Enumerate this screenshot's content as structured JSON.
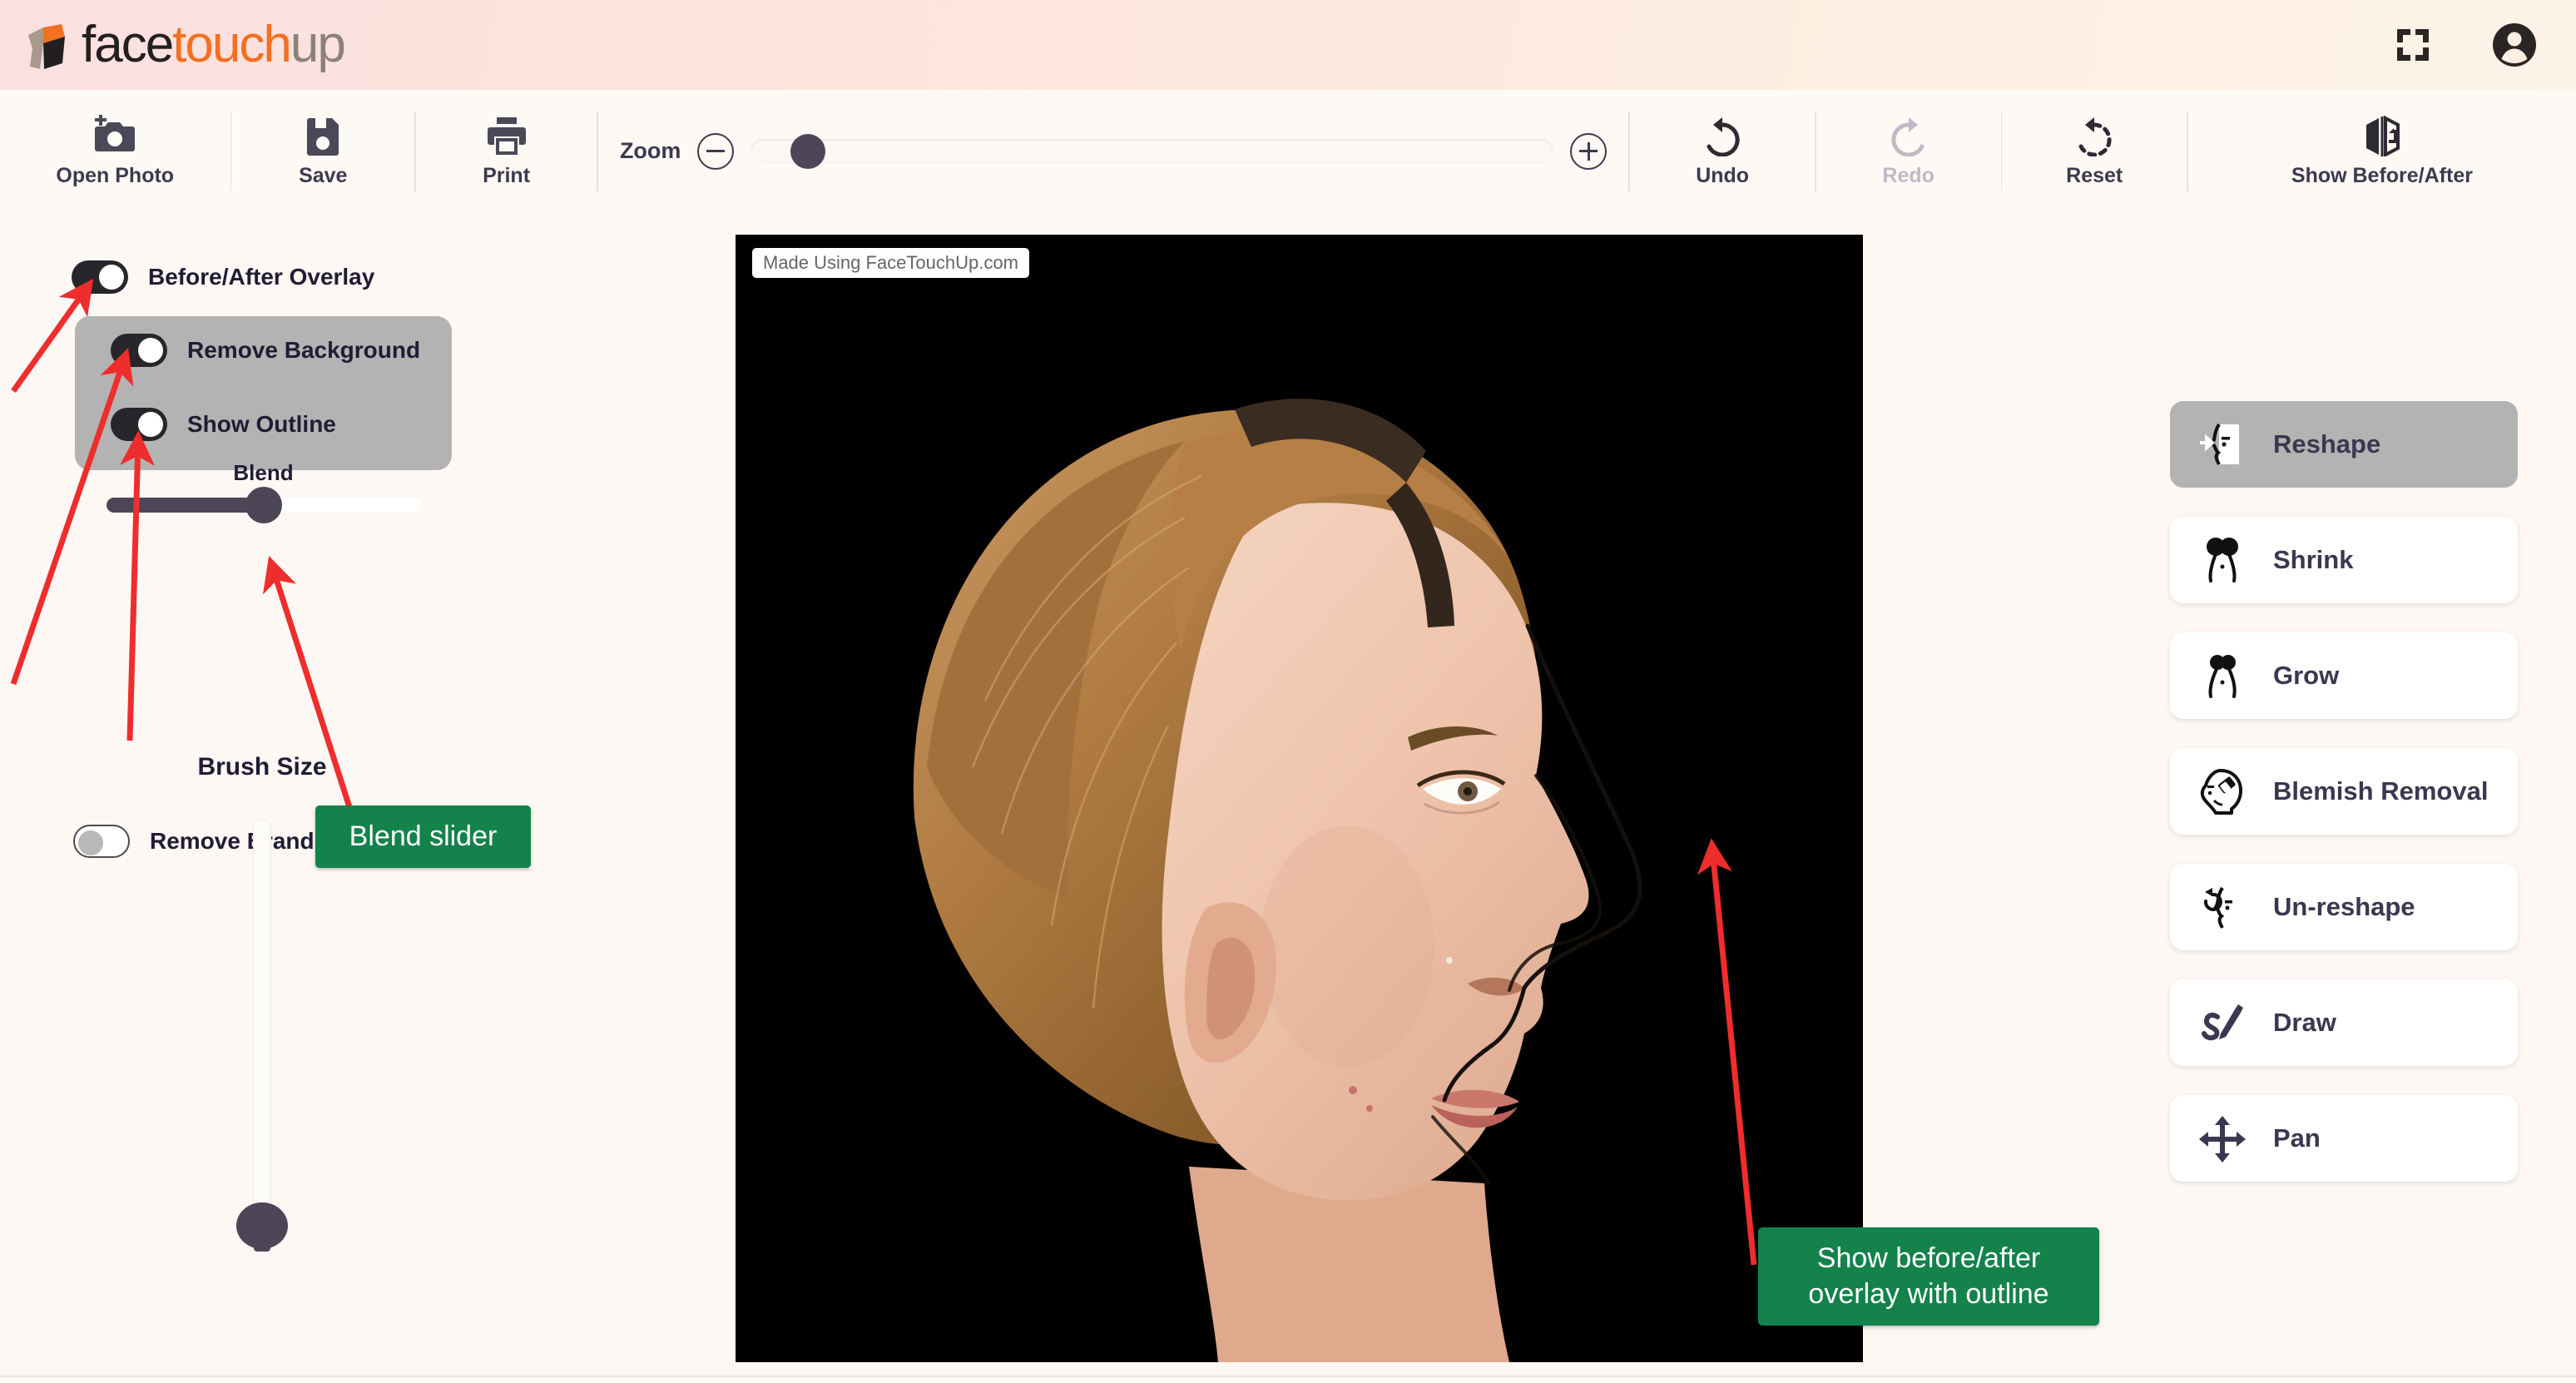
{
  "header": {
    "brand": {
      "part1": "face",
      "part2": "touch",
      "part3": "up"
    },
    "fullscreen_icon": "fullscreen-icon",
    "account_icon": "account-avatar-icon"
  },
  "toolbar": {
    "open_photo": "Open Photo",
    "save": "Save",
    "print": "Print",
    "zoom_label": "Zoom",
    "zoom_out": "zoom-out-icon",
    "zoom_in": "zoom-in-icon",
    "zoom_value": 5,
    "undo": "Undo",
    "redo": "Redo",
    "redo_disabled": true,
    "reset": "Reset",
    "show_before_after": "Show Before/After"
  },
  "left_panel": {
    "before_after_overlay": {
      "label": "Before/After Overlay",
      "on": true
    },
    "remove_background": {
      "label": "Remove Background",
      "on": true
    },
    "show_outline": {
      "label": "Show Outline",
      "on": true
    },
    "blend": {
      "label": "Blend",
      "value": 50
    },
    "remove_branding": {
      "label": "Remove Branding",
      "on": false
    },
    "brush_size": {
      "label": "Brush Size",
      "value": 0
    }
  },
  "canvas": {
    "watermark": "Made Using FaceTouchUp.com"
  },
  "tools": [
    {
      "label": "Reshape",
      "icon": "face-profile-reshape-icon",
      "active": true
    },
    {
      "label": "Shrink",
      "icon": "shrink-pinch-icon",
      "active": false
    },
    {
      "label": "Grow",
      "icon": "grow-expand-icon",
      "active": false
    },
    {
      "label": "Blemish Removal",
      "icon": "head-eraser-icon",
      "active": false
    },
    {
      "label": "Un-reshape",
      "icon": "face-profile-undo-icon",
      "active": false
    },
    {
      "label": "Draw",
      "icon": "pencil-draw-icon",
      "active": false
    },
    {
      "label": "Pan",
      "icon": "move-arrows-icon",
      "active": false
    }
  ],
  "annotations": {
    "blend_callout": "Blend slider",
    "overlay_callout_line1": "Show before/after",
    "overlay_callout_line2": "overlay with outline",
    "arrow_color": "#ee2d2d",
    "callout_color": "#13824b"
  }
}
